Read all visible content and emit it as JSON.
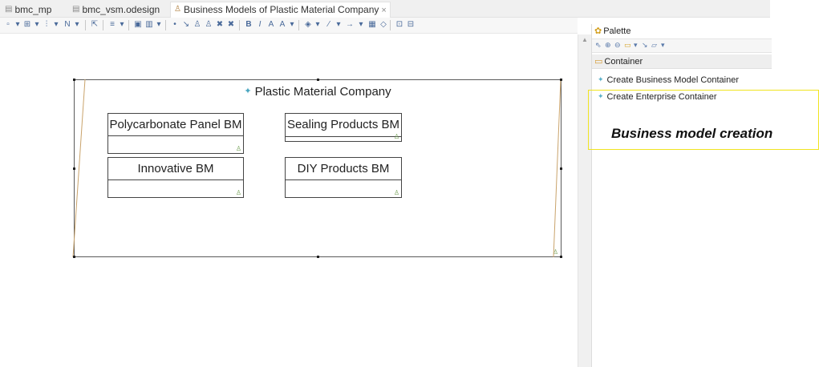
{
  "tabs": [
    {
      "label": "bmc_mp",
      "icon": "file-icon"
    },
    {
      "label": "bmc_vsm.odesign",
      "icon": "file-icon"
    },
    {
      "label": "Business Models of Plastic Material Company",
      "icon": "diagram-icon",
      "active": true,
      "close": "×"
    }
  ],
  "diagram": {
    "enterprise": {
      "title": "Plastic Material Company",
      "icon": "container-star-icon"
    },
    "business_models": [
      {
        "label": "Polycarbonate Panel BM"
      },
      {
        "label": "Sealing Products BM"
      },
      {
        "label": "Innovative BM"
      },
      {
        "label": "DIY Products BM"
      }
    ]
  },
  "palette": {
    "title": "Palette",
    "drawer": "Container",
    "entries": [
      {
        "label": "Create Business Model Container"
      },
      {
        "label": "Create Enterprise Container"
      }
    ]
  },
  "annotation": {
    "text": "Business model creation",
    "color": "#f0e420"
  }
}
